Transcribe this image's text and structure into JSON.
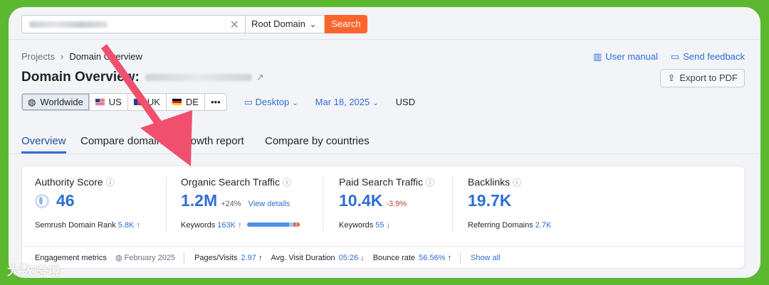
{
  "search": {
    "domain_select": "Root Domain",
    "button": "Search"
  },
  "breadcrumb": {
    "root": "Projects",
    "current": "Domain Overview"
  },
  "header_links": {
    "manual": "User manual",
    "feedback": "Send feedback"
  },
  "page_title": "Domain Overview:",
  "export_label": "Export to PDF",
  "geo": [
    {
      "label": "Worldwide",
      "icon": "globe-icon"
    },
    {
      "label": "US",
      "icon": "flag-us-icon"
    },
    {
      "label": "UK",
      "icon": "flag-uk-icon"
    },
    {
      "label": "DE",
      "icon": "flag-de-icon"
    },
    {
      "label": "•••",
      "icon": "more-icon"
    }
  ],
  "device": "Desktop",
  "date": "Mar 18, 2025",
  "currency": "USD",
  "tabs": [
    {
      "label": "Overview",
      "active": true
    },
    {
      "label": "Compare domains",
      "active": false
    },
    {
      "label": "Growth report",
      "active": false
    },
    {
      "label": "Compare by countries",
      "active": false
    }
  ],
  "metrics": {
    "authority": {
      "label": "Authority Score",
      "value": "46",
      "sub_label": "Semrush Domain Rank",
      "sub_value": "5.8K"
    },
    "organic": {
      "label": "Organic Search Traffic",
      "value": "1.2M",
      "delta": "+24%",
      "link": "View details",
      "sub_label": "Keywords",
      "sub_value": "163K"
    },
    "paid": {
      "label": "Paid Search Traffic",
      "value": "10.4K",
      "delta": "-3.9%",
      "sub_label": "Keywords",
      "sub_value": "55"
    },
    "backlinks": {
      "label": "Backlinks",
      "value": "19.7K",
      "sub_label": "Referring Domains",
      "sub_value": "2.7K"
    }
  },
  "engagement": {
    "label": "Engagement metrics",
    "period": "February 2025",
    "pages_label": "Pages/Visits",
    "pages_value": "2.97",
    "duration_label": "Avg. Visit Duration",
    "duration_value": "05:26",
    "bounce_label": "Bounce rate",
    "bounce_value": "56.56%",
    "show_all": "Show all"
  },
  "watermark": "大数跨境",
  "colors": {
    "accent": "#2e6ed6",
    "search_button": "#ff642d",
    "frame": "#5cb82e",
    "arrow": "#f0506e"
  }
}
